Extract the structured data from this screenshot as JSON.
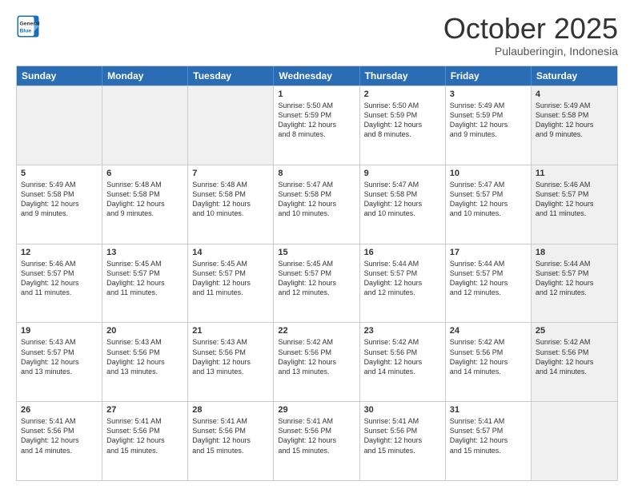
{
  "header": {
    "logo_line1": "General",
    "logo_line2": "Blue",
    "month": "October 2025",
    "location": "Pulauberingin, Indonesia"
  },
  "weekdays": [
    "Sunday",
    "Monday",
    "Tuesday",
    "Wednesday",
    "Thursday",
    "Friday",
    "Saturday"
  ],
  "rows": [
    [
      {
        "day": "",
        "info": "",
        "shaded": true
      },
      {
        "day": "",
        "info": "",
        "shaded": true
      },
      {
        "day": "",
        "info": "",
        "shaded": true
      },
      {
        "day": "1",
        "info": "Sunrise: 5:50 AM\nSunset: 5:59 PM\nDaylight: 12 hours\nand 8 minutes.",
        "shaded": false
      },
      {
        "day": "2",
        "info": "Sunrise: 5:50 AM\nSunset: 5:59 PM\nDaylight: 12 hours\nand 8 minutes.",
        "shaded": false
      },
      {
        "day": "3",
        "info": "Sunrise: 5:49 AM\nSunset: 5:59 PM\nDaylight: 12 hours\nand 9 minutes.",
        "shaded": false
      },
      {
        "day": "4",
        "info": "Sunrise: 5:49 AM\nSunset: 5:58 PM\nDaylight: 12 hours\nand 9 minutes.",
        "shaded": true
      }
    ],
    [
      {
        "day": "5",
        "info": "Sunrise: 5:49 AM\nSunset: 5:58 PM\nDaylight: 12 hours\nand 9 minutes.",
        "shaded": false
      },
      {
        "day": "6",
        "info": "Sunrise: 5:48 AM\nSunset: 5:58 PM\nDaylight: 12 hours\nand 9 minutes.",
        "shaded": false
      },
      {
        "day": "7",
        "info": "Sunrise: 5:48 AM\nSunset: 5:58 PM\nDaylight: 12 hours\nand 10 minutes.",
        "shaded": false
      },
      {
        "day": "8",
        "info": "Sunrise: 5:47 AM\nSunset: 5:58 PM\nDaylight: 12 hours\nand 10 minutes.",
        "shaded": false
      },
      {
        "day": "9",
        "info": "Sunrise: 5:47 AM\nSunset: 5:58 PM\nDaylight: 12 hours\nand 10 minutes.",
        "shaded": false
      },
      {
        "day": "10",
        "info": "Sunrise: 5:47 AM\nSunset: 5:57 PM\nDaylight: 12 hours\nand 10 minutes.",
        "shaded": false
      },
      {
        "day": "11",
        "info": "Sunrise: 5:46 AM\nSunset: 5:57 PM\nDaylight: 12 hours\nand 11 minutes.",
        "shaded": true
      }
    ],
    [
      {
        "day": "12",
        "info": "Sunrise: 5:46 AM\nSunset: 5:57 PM\nDaylight: 12 hours\nand 11 minutes.",
        "shaded": false
      },
      {
        "day": "13",
        "info": "Sunrise: 5:45 AM\nSunset: 5:57 PM\nDaylight: 12 hours\nand 11 minutes.",
        "shaded": false
      },
      {
        "day": "14",
        "info": "Sunrise: 5:45 AM\nSunset: 5:57 PM\nDaylight: 12 hours\nand 11 minutes.",
        "shaded": false
      },
      {
        "day": "15",
        "info": "Sunrise: 5:45 AM\nSunset: 5:57 PM\nDaylight: 12 hours\nand 12 minutes.",
        "shaded": false
      },
      {
        "day": "16",
        "info": "Sunrise: 5:44 AM\nSunset: 5:57 PM\nDaylight: 12 hours\nand 12 minutes.",
        "shaded": false
      },
      {
        "day": "17",
        "info": "Sunrise: 5:44 AM\nSunset: 5:57 PM\nDaylight: 12 hours\nand 12 minutes.",
        "shaded": false
      },
      {
        "day": "18",
        "info": "Sunrise: 5:44 AM\nSunset: 5:57 PM\nDaylight: 12 hours\nand 12 minutes.",
        "shaded": true
      }
    ],
    [
      {
        "day": "19",
        "info": "Sunrise: 5:43 AM\nSunset: 5:57 PM\nDaylight: 12 hours\nand 13 minutes.",
        "shaded": false
      },
      {
        "day": "20",
        "info": "Sunrise: 5:43 AM\nSunset: 5:56 PM\nDaylight: 12 hours\nand 13 minutes.",
        "shaded": false
      },
      {
        "day": "21",
        "info": "Sunrise: 5:43 AM\nSunset: 5:56 PM\nDaylight: 12 hours\nand 13 minutes.",
        "shaded": false
      },
      {
        "day": "22",
        "info": "Sunrise: 5:42 AM\nSunset: 5:56 PM\nDaylight: 12 hours\nand 13 minutes.",
        "shaded": false
      },
      {
        "day": "23",
        "info": "Sunrise: 5:42 AM\nSunset: 5:56 PM\nDaylight: 12 hours\nand 14 minutes.",
        "shaded": false
      },
      {
        "day": "24",
        "info": "Sunrise: 5:42 AM\nSunset: 5:56 PM\nDaylight: 12 hours\nand 14 minutes.",
        "shaded": false
      },
      {
        "day": "25",
        "info": "Sunrise: 5:42 AM\nSunset: 5:56 PM\nDaylight: 12 hours\nand 14 minutes.",
        "shaded": true
      }
    ],
    [
      {
        "day": "26",
        "info": "Sunrise: 5:41 AM\nSunset: 5:56 PM\nDaylight: 12 hours\nand 14 minutes.",
        "shaded": false
      },
      {
        "day": "27",
        "info": "Sunrise: 5:41 AM\nSunset: 5:56 PM\nDaylight: 12 hours\nand 15 minutes.",
        "shaded": false
      },
      {
        "day": "28",
        "info": "Sunrise: 5:41 AM\nSunset: 5:56 PM\nDaylight: 12 hours\nand 15 minutes.",
        "shaded": false
      },
      {
        "day": "29",
        "info": "Sunrise: 5:41 AM\nSunset: 5:56 PM\nDaylight: 12 hours\nand 15 minutes.",
        "shaded": false
      },
      {
        "day": "30",
        "info": "Sunrise: 5:41 AM\nSunset: 5:56 PM\nDaylight: 12 hours\nand 15 minutes.",
        "shaded": false
      },
      {
        "day": "31",
        "info": "Sunrise: 5:41 AM\nSunset: 5:57 PM\nDaylight: 12 hours\nand 15 minutes.",
        "shaded": false
      },
      {
        "day": "",
        "info": "",
        "shaded": true
      }
    ]
  ]
}
